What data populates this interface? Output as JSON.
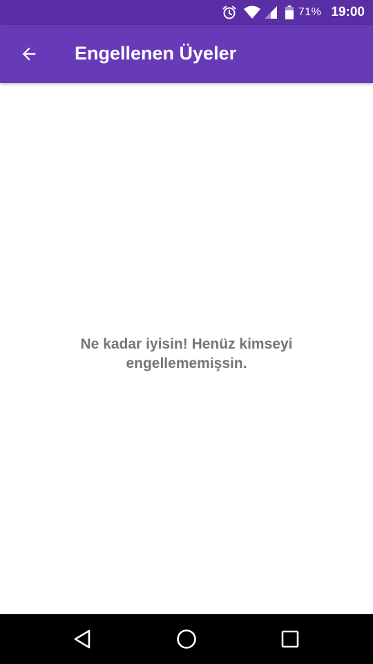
{
  "status_bar": {
    "icons": [
      "alarm-icon",
      "wifi-icon",
      "cellular-signal-icon",
      "battery-icon"
    ],
    "battery_percent": "71%",
    "time": "19:00",
    "color": "#5a2fa6"
  },
  "app_bar": {
    "back_icon": "arrow-back-icon",
    "title": "Engellenen Üyeler",
    "color": "#673ab7"
  },
  "content": {
    "empty_message": "Ne kadar iyisin! Henüz kimseyi engellememişsin."
  },
  "nav_bar": {
    "icons": [
      "nav-back-icon",
      "nav-home-icon",
      "nav-recents-icon"
    ]
  }
}
